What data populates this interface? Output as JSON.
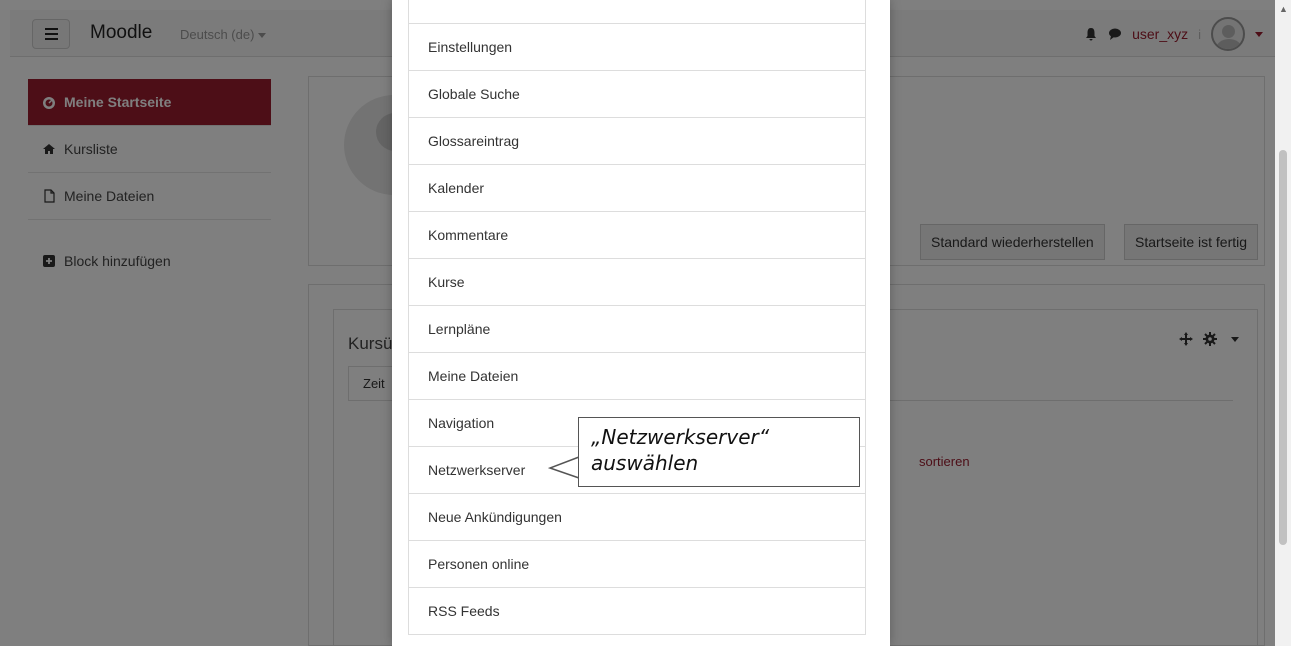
{
  "navbar": {
    "brand": "Moodle",
    "language": "Deutsch (de)",
    "username": "user_xyz",
    "sep": "i"
  },
  "sidebar": {
    "items": [
      {
        "label": "Meine Startseite"
      },
      {
        "label": "Kursliste"
      },
      {
        "label": "Meine Dateien"
      }
    ],
    "add_block": "Block hinzufügen"
  },
  "header": {
    "reset_button": "Standard wiederherstellen",
    "done_button": "Startseite ist fertig"
  },
  "course_overview": {
    "title": "Kursü",
    "tab": "Zeit",
    "sort_link": "sortieren"
  },
  "modal": {
    "items": [
      "Einstellungen",
      "Globale Suche",
      "Glossareintrag",
      "Kalender",
      "Kommentare",
      "Kurse",
      "Lernpläne",
      "Meine Dateien",
      "Navigation",
      "Netzwerkserver",
      "Neue Ankündigungen",
      "Personen online",
      "RSS Feeds"
    ]
  },
  "callout": {
    "line1": "„Netzwerkserver“",
    "line2": "auswählen"
  },
  "colors": {
    "accent": "#9b1c2e"
  }
}
